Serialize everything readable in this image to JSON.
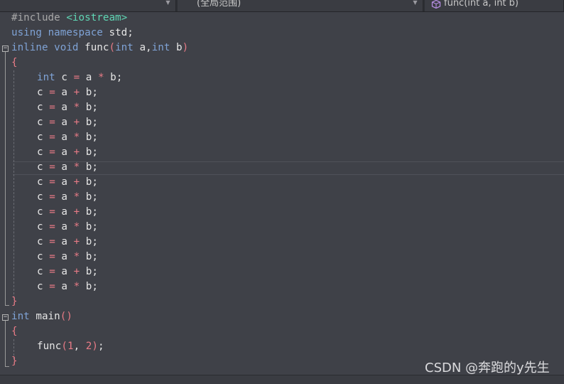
{
  "navbar": {
    "project_scope": "",
    "scope": "(全局范围)",
    "member": "func(int a, int b)",
    "colors": {
      "background": "#2d2f34",
      "segment": "#3a3c42"
    }
  },
  "editor": {
    "colors": {
      "background": "#3f4148",
      "keyword": "#7fa3d6",
      "string": "#5fd6b4",
      "operator": "#e87b86",
      "identifier": "#e6e6e6"
    },
    "code": {
      "l1": {
        "directive": "#include",
        "header": "<iostream>"
      },
      "l2": {
        "kw1": "using",
        "kw2": "namespace",
        "rest": "std;"
      },
      "l3": {
        "kw_inline": "inline",
        "kw_void": "void",
        "name": "func",
        "lparen": "(",
        "kw_int1": "int",
        "param1": "a,",
        "kw_int2": "int",
        "param2": "b",
        "rparen": ")"
      },
      "l4": {
        "brace": "{"
      },
      "l5": {
        "kw": "int",
        "lhs": "c",
        "eq": "=",
        "a": "a",
        "op": "*",
        "b": "b;"
      },
      "body_lines": [
        {
          "lhs": "c",
          "eq": "=",
          "a": "a",
          "op": "+",
          "b": "b;"
        },
        {
          "lhs": "c",
          "eq": "=",
          "a": "a",
          "op": "*",
          "b": "b;"
        },
        {
          "lhs": "c",
          "eq": "=",
          "a": "a",
          "op": "+",
          "b": "b;"
        },
        {
          "lhs": "c",
          "eq": "=",
          "a": "a",
          "op": "*",
          "b": "b;"
        },
        {
          "lhs": "c",
          "eq": "=",
          "a": "a",
          "op": "+",
          "b": "b;"
        },
        {
          "lhs": "c",
          "eq": "=",
          "a": "a",
          "op": "*",
          "b": "b;"
        },
        {
          "lhs": "c",
          "eq": "=",
          "a": "a",
          "op": "+",
          "b": "b;"
        },
        {
          "lhs": "c",
          "eq": "=",
          "a": "a",
          "op": "*",
          "b": "b;"
        },
        {
          "lhs": "c",
          "eq": "=",
          "a": "a",
          "op": "+",
          "b": "b;"
        },
        {
          "lhs": "c",
          "eq": "=",
          "a": "a",
          "op": "*",
          "b": "b;"
        },
        {
          "lhs": "c",
          "eq": "=",
          "a": "a",
          "op": "+",
          "b": "b;"
        },
        {
          "lhs": "c",
          "eq": "=",
          "a": "a",
          "op": "*",
          "b": "b;"
        },
        {
          "lhs": "c",
          "eq": "=",
          "a": "a",
          "op": "+",
          "b": "b;"
        },
        {
          "lhs": "c",
          "eq": "=",
          "a": "a",
          "op": "*",
          "b": "b;"
        }
      ],
      "l20": {
        "brace": "}"
      },
      "l21": {
        "kw_int": "int",
        "name": "main",
        "parens": "()"
      },
      "l22": {
        "brace": "{"
      },
      "l23": {
        "name": "func",
        "lparen": "(",
        "arg1": "1",
        "comma": ", ",
        "arg2": "2",
        "rparen": ")",
        "semi": ";"
      },
      "l24": {
        "brace": "}"
      }
    }
  },
  "watermark": {
    "text": "CSDN @奔跑的y先生"
  }
}
